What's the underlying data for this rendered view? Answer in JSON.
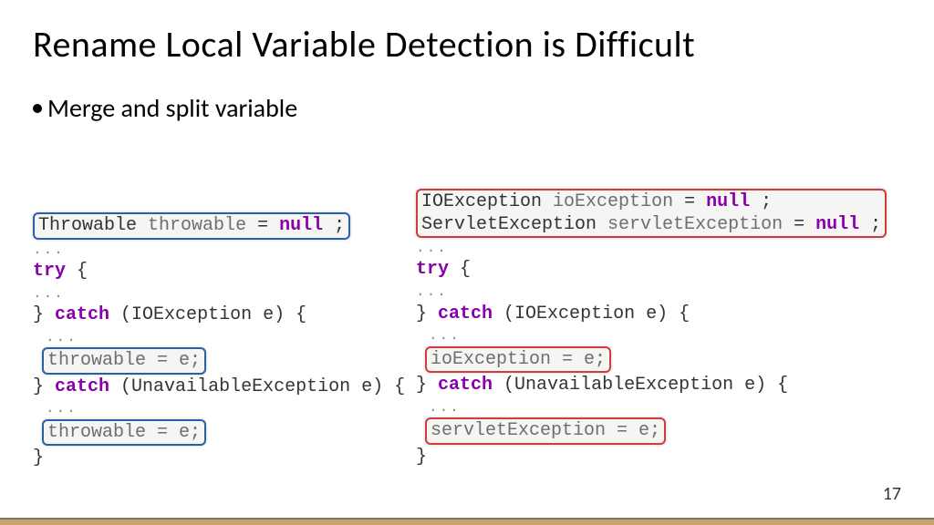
{
  "title": "Rename Local Variable Detection is Difficult",
  "bullet": "Merge and split variable",
  "left": {
    "l1_type": "Throwable",
    "l1_var": "throwable",
    "l1_eq": " = ",
    "l1_null": "null",
    "l1_semi": ";",
    "dots": "...",
    "try": "try",
    "brace_open": " {",
    "rbrace": "}",
    "catch": "catch",
    "catch1_open": " (IOException e) {",
    "assign1": "throwable = e;",
    "catch2_open": " (UnavailableException e) {",
    "assign2": "throwable = e;"
  },
  "right": {
    "l1_type": "IOException",
    "l1_var": "ioException",
    "l1_eq": " = ",
    "l1_null": "null",
    "l1_semi": ";",
    "l2_type": "ServletException",
    "l2_var": "servletException",
    "l2_eq": " = ",
    "l2_null": "null",
    "l2_semi": ";",
    "dots": "...",
    "try": "try",
    "brace_open": " {",
    "rbrace": "}",
    "catch": "catch",
    "catch1_open": " (IOException e) {",
    "assign1": "ioException = e;",
    "catch2_open": " (UnavailableException e) {",
    "assign2": "servletException = e;"
  },
  "page_number": "17"
}
